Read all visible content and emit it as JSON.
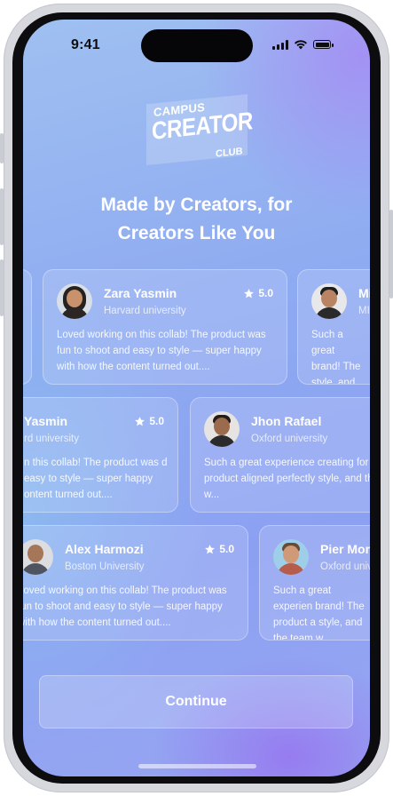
{
  "status_bar": {
    "time": "9:41"
  },
  "logo": {
    "top": "CAMPUS",
    "main": "CREATOR",
    "bottom": "CLUB"
  },
  "headline": {
    "line1": "Made by Creators, for",
    "line2": "Creators Like You"
  },
  "reviews": [
    {
      "name": "Zara Yasmin",
      "school": "Harvard university",
      "rating": "5.0",
      "text": "Loved working on this collab! The product was fun to shoot and easy to style — super happy with how the content turned out...."
    },
    {
      "name": "Mi",
      "school": "MIT",
      "rating": "",
      "text": "Such a great brand! The style, and the"
    },
    {
      "name": "Yasmin",
      "school": "rd university",
      "rating": "5.0",
      "text": "n this collab! The product was d easy to style — super happy ontent turned out...."
    },
    {
      "name": "Jhon Rafael",
      "school": "Oxford university",
      "rating": "",
      "text": "Such a great experience creating for brand! The product aligned perfectly style, and the team w..."
    },
    {
      "name": "Alex Harmozi",
      "school": "Boston University",
      "rating": "5.0",
      "text": "Loved working on this collab! The product was fun to shoot and easy to style — super happy with how the content turned out...."
    },
    {
      "name": "Pier More",
      "school": "Oxford unive",
      "rating": "",
      "text": "Such a great experien brand! The product a style, and the team w"
    }
  ],
  "continue_button": {
    "label": "Continue"
  }
}
